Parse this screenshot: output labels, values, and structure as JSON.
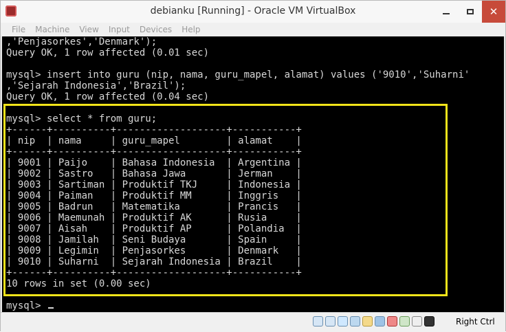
{
  "window": {
    "title": "debianku [Running] - Oracle VM VirtualBox",
    "controls": {
      "minimize": "─",
      "maximize": "□",
      "close": "✕"
    }
  },
  "menu": [
    "File",
    "Machine",
    "View",
    "Input",
    "Devices",
    "Help"
  ],
  "terminal": {
    "lines": [
      ",'Penjasorkes','Denmark');",
      "Query OK, 1 row affected (0.01 sec)",
      "",
      "mysql> insert into guru (nip, nama, guru_mapel, alamat) values ('9010','Suharni'",
      ",'Sejarah Indonesia','Brazil');",
      "Query OK, 1 row affected (0.04 sec)",
      "",
      "mysql> select * from guru;",
      "+------+----------+-------------------+-----------+",
      "| nip  | nama     | guru_mapel        | alamat    |",
      "+------+----------+-------------------+-----------+",
      "| 9001 | Paijo    | Bahasa Indonesia  | Argentina |",
      "| 9002 | Sastro   | Bahasa Jawa       | Jerman    |",
      "| 9003 | Sartiman | Produktif TKJ     | Indonesia |",
      "| 9004 | Paiman   | Produktif MM      | Inggris   |",
      "| 9005 | Badrun   | Matematika        | Prancis   |",
      "| 9006 | Maemunah | Produktif AK      | Rusia     |",
      "| 9007 | Aisah    | Produktif AP      | Polandia  |",
      "| 9008 | Jamilah  | Seni Budaya       | Spain     |",
      "| 9009 | Legimin  | Penjasorkes       | Denmark   |",
      "| 9010 | Suharni  | Sejarah Indonesia | Brazil    |",
      "+------+----------+-------------------+-----------+",
      "10 rows in set (0.00 sec)",
      "",
      "mysql> "
    ]
  },
  "status": {
    "icons": [
      "storage-icon",
      "optical-icon",
      "network-icon",
      "usb-icon",
      "shared-folder-icon",
      "display-icon",
      "video-capture-icon",
      "cpu-icon",
      "mouse-integration-icon",
      "down-arrow-icon"
    ],
    "host_key": "Right Ctrl"
  },
  "colors": {
    "highlight": "#f3e41a",
    "terminal_bg": "#000000",
    "terminal_fg": "#d8d8d8",
    "close_button": "#c74a3a"
  }
}
